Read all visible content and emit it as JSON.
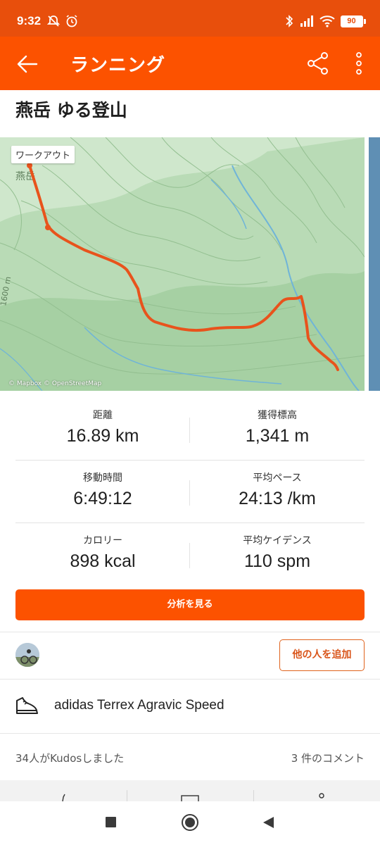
{
  "status_bar": {
    "time": "9:32",
    "battery": "90",
    "icons": [
      "muted-bell-icon",
      "alarm-icon",
      "bluetooth-icon",
      "signal-icon",
      "wifi-icon",
      "battery-icon"
    ]
  },
  "app_bar": {
    "title": "ランニング",
    "icons": [
      "back-arrow-icon",
      "share-icon",
      "more-vertical-icon"
    ]
  },
  "activity": {
    "title": "燕岳 ゆる登山"
  },
  "map": {
    "label": "ワークアウト",
    "place_label": "燕岳",
    "contour_label": "1600 m",
    "attribution": "© Mapbox © OpenStreetMap",
    "route_color": "#e8531c"
  },
  "stats": [
    [
      {
        "label": "距離",
        "value": "16.89 km"
      },
      {
        "label": "獲得標高",
        "value": "1,341 m"
      }
    ],
    [
      {
        "label": "移動時間",
        "value": "6:49:12"
      },
      {
        "label": "平均ペース",
        "value": "24:13 /km"
      }
    ],
    [
      {
        "label": "カロリー",
        "value": "898 kcal"
      },
      {
        "label": "平均ケイデンス",
        "value": "110 spm"
      }
    ]
  ],
  "analyze_button": "分析を見る",
  "add_people_button": "他の人を追加",
  "gear": {
    "name": "adidas Terrex Agravic Speed",
    "icon": "shoe-icon"
  },
  "social": {
    "kudos": "34人がKudosしました",
    "comments": "3 件のコメント"
  },
  "colors": {
    "brand": "#fc5200",
    "status_bar": "#e84f0c"
  }
}
